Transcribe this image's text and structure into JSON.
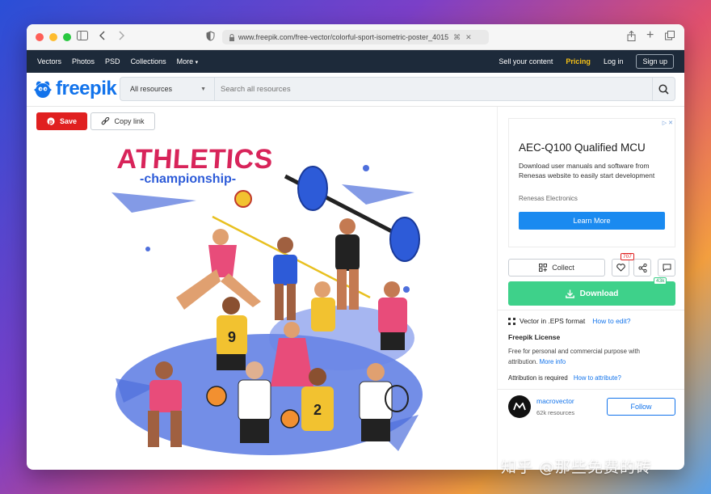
{
  "browser": {
    "url": "www.freepik.com/free-vector/colorful-sport-isometric-poster_4015"
  },
  "topnav": {
    "items": [
      "Vectors",
      "Photos",
      "PSD",
      "Collections",
      "More"
    ],
    "sell": "Sell your content",
    "pricing": "Pricing",
    "login": "Log in",
    "signup": "Sign up",
    "pricing_color": "#f5c016"
  },
  "header": {
    "logo_text": "freepik",
    "search_category": "All resources",
    "search_placeholder": "Search all resources"
  },
  "actions": {
    "save": "Save",
    "copy_link": "Copy link"
  },
  "poster": {
    "title": "ATHLETICS",
    "subtitle": "-championship-"
  },
  "ad": {
    "title": "AEC-Q100 Qualified MCU",
    "body": "Download user manuals and software from Renesas website to easily start development",
    "brand": "Renesas Electronics",
    "button": "Learn More"
  },
  "resource": {
    "collect": "Collect",
    "likes": "707",
    "download": "Download",
    "downloads": "43k",
    "format": "Vector in .EPS format",
    "how_to_edit": "How to edit?",
    "license_title": "Freepik License",
    "license_body": "Free for personal and commercial purpose with attribution.",
    "more_info": "More info",
    "attribution": "Attribution is required",
    "how_to_attribute": "How to attribute?",
    "accent": "#3ed18a"
  },
  "author": {
    "name": "macrovector",
    "resources": "62k resources",
    "follow": "Follow"
  },
  "watermark": "知乎 @那些免费的砖"
}
